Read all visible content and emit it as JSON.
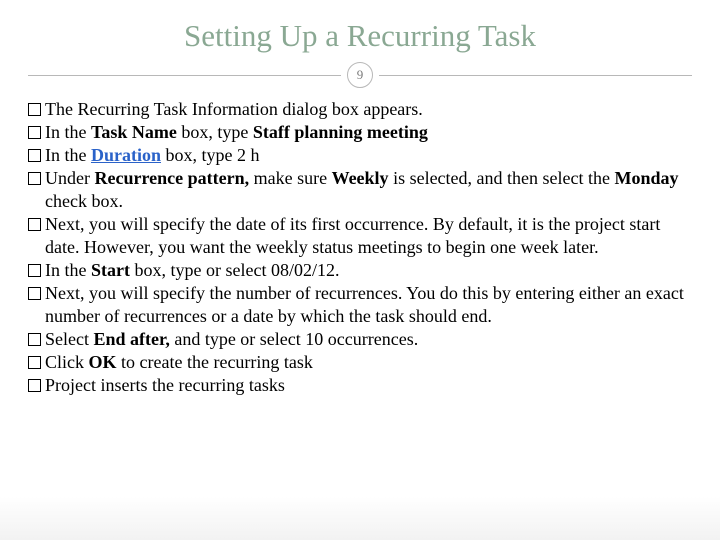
{
  "title": "Setting Up a Recurring Task",
  "page_number": "9",
  "items": [
    {
      "segments": [
        {
          "t": "The Recurring Task Information dialog box appears."
        }
      ]
    },
    {
      "segments": [
        {
          "t": "In the "
        },
        {
          "t": "Task Name",
          "b": true
        },
        {
          "t": " box, type "
        },
        {
          "t": "Staff planning meeting",
          "b": true
        }
      ]
    },
    {
      "segments": [
        {
          "t": "In the "
        },
        {
          "t": "Duration",
          "link": true
        },
        {
          "t": " box, type 2 h"
        }
      ]
    },
    {
      "segments": [
        {
          "t": "Under "
        },
        {
          "t": "Recurrence pattern,",
          "b": true
        },
        {
          "t": " make sure "
        },
        {
          "t": "Weekly",
          "b": true
        },
        {
          "t": " is selected, and then select the "
        },
        {
          "t": "Monday",
          "b": true
        },
        {
          "t": " check box."
        }
      ]
    },
    {
      "segments": [
        {
          "t": "Next, you will specify the date of its first occurrence. By default, it is the project start date. However, you want the weekly status meetings to begin one week later."
        }
      ]
    },
    {
      "segments": [
        {
          "t": "In the "
        },
        {
          "t": "Start",
          "b": true
        },
        {
          "t": " box, type or select 08/02/12."
        }
      ]
    },
    {
      "segments": [
        {
          "t": "Next, you will specify the number of recurrences. You do this by entering either an exact number of recurrences or a date by which the task should end."
        }
      ]
    },
    {
      "segments": [
        {
          "t": "Select "
        },
        {
          "t": "End after,",
          "b": true
        },
        {
          "t": " and type or select 10 occurrences."
        }
      ]
    },
    {
      "segments": [
        {
          "t": "Click "
        },
        {
          "t": "OK",
          "b": true
        },
        {
          "t": " to create the recurring task"
        }
      ]
    },
    {
      "segments": [
        {
          "t": "Project inserts the recurring tasks"
        }
      ]
    }
  ]
}
